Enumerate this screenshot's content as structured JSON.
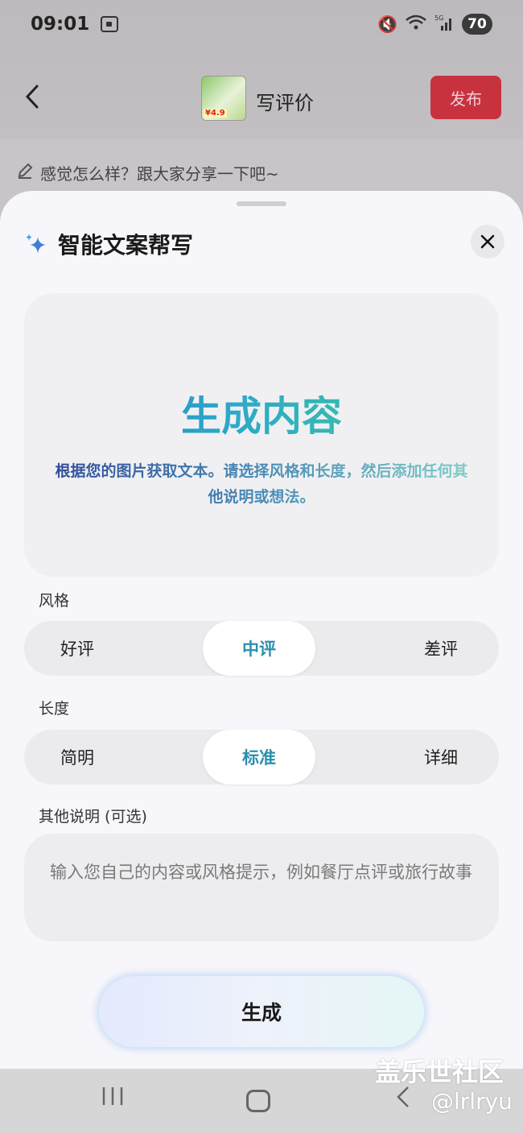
{
  "status_bar": {
    "time": "09:01",
    "network": "5G",
    "battery": "70"
  },
  "header": {
    "title": "写评价",
    "publish_label": "发布"
  },
  "review_hint": "感觉怎么样？跟大家分享一下吧~",
  "sheet": {
    "title": "智能文案帮写",
    "card": {
      "title": "生成内容",
      "description": "根据您的图片获取文本。请选择风格和长度，然后添加任何其他说明或想法。"
    },
    "style": {
      "label": "风格",
      "options": [
        "好评",
        "中评",
        "差评"
      ],
      "selected": "中评"
    },
    "length": {
      "label": "长度",
      "options": [
        "简明",
        "标准",
        "详细"
      ],
      "selected": "标准"
    },
    "notes": {
      "label": "其他说明 (可选)",
      "placeholder": "输入您自己的内容或风格提示，例如餐厅点评或旅行故事"
    },
    "generate_label": "生成"
  },
  "watermark": {
    "title": "盖乐世社区",
    "user": "@lrlryu"
  },
  "colors": {
    "publish": "#c8323f",
    "accent": "#2a8fae",
    "gradient_start": "#1d7fc7",
    "gradient_end": "#3fd08a"
  },
  "icons": [
    "scan-icon",
    "mute-icon",
    "wifi-icon",
    "signal-icon",
    "back-icon",
    "pencil-icon",
    "sparkle-icon",
    "close-icon",
    "recent-apps-icon",
    "home-icon",
    "nav-back-icon"
  ]
}
